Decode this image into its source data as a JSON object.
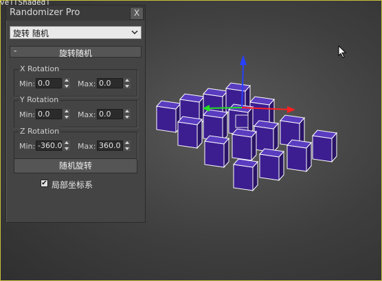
{
  "viewport": {
    "label": "ve][Shaded]",
    "frame_color": "#c9c23a",
    "cube_color": "#3c1e90"
  },
  "window": {
    "title": "Randomizer Pro",
    "close_label": "X"
  },
  "mode_dropdown": {
    "selected": "旋转 随机"
  },
  "rollout": {
    "toggle": "-",
    "title": "旋转随机"
  },
  "groups": [
    {
      "title": "X Rotation",
      "min_label": "Min:",
      "min_value": "0.0",
      "max_label": "Max:",
      "max_value": "0.0"
    },
    {
      "title": "Y Rotation",
      "min_label": "Min:",
      "min_value": "0.0",
      "max_label": "Max:",
      "max_value": "0.0"
    },
    {
      "title": "Z Rotation",
      "min_label": "Min:",
      "min_value": "-360.0",
      "max_label": "Max:",
      "max_value": "360.0"
    }
  ],
  "action_button": {
    "label": "随机旋转"
  },
  "local_coords": {
    "label": "局部坐标系",
    "checked": true
  }
}
